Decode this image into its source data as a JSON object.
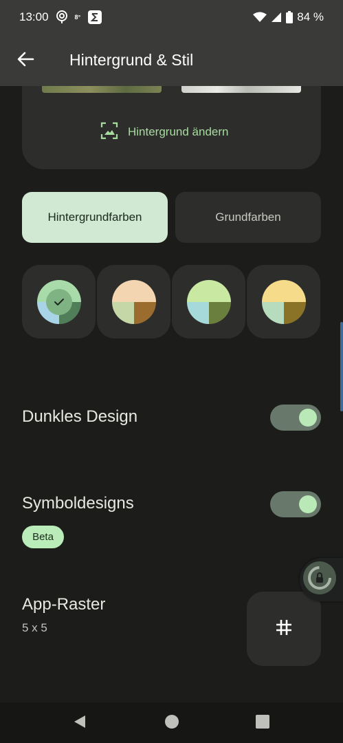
{
  "status_bar": {
    "time": "13:00",
    "temperature": "8°",
    "battery": "84 %",
    "icons": [
      "location-ring-icon",
      "weather-icon",
      "sigma-app-icon",
      "wifi-icon",
      "signal-icon",
      "battery-icon"
    ]
  },
  "app_bar": {
    "title": "Hintergrund & Stil",
    "back_icon": "arrow-back-icon"
  },
  "wallpaper": {
    "change_label": "Hintergrund ändern",
    "icon": "wallpaper-icon"
  },
  "tabs": [
    {
      "label": "Hintergrundfarben",
      "selected": true
    },
    {
      "label": "Grundfarben",
      "selected": false
    }
  ],
  "color_options": [
    {
      "selected": true,
      "colors": [
        "#a8dba9",
        "#a9d3e6",
        "#4f7e58",
        "#7fb384"
      ]
    },
    {
      "selected": false,
      "colors": [
        "#f3d5b1",
        "#c6d7a7",
        "#9a6c2e"
      ]
    },
    {
      "selected": false,
      "colors": [
        "#c9e8a2",
        "#a6d9d9",
        "#6a7f3e"
      ]
    },
    {
      "selected": false,
      "colors": [
        "#f6dc8a",
        "#b6dbbd",
        "#8a7227"
      ]
    }
  ],
  "settings": {
    "dark_theme": {
      "label": "Dunkles Design",
      "enabled": true
    },
    "themed_icons": {
      "label": "Symboldesigns",
      "badge": "Beta",
      "enabled": true
    },
    "app_grid": {
      "label": "App-Raster",
      "value": "5 x 5",
      "icon": "grid-hash-icon"
    }
  },
  "accent_color": "#a8dba0",
  "navigation": [
    "back-triangle-icon",
    "home-circle-icon",
    "recents-square-icon"
  ]
}
